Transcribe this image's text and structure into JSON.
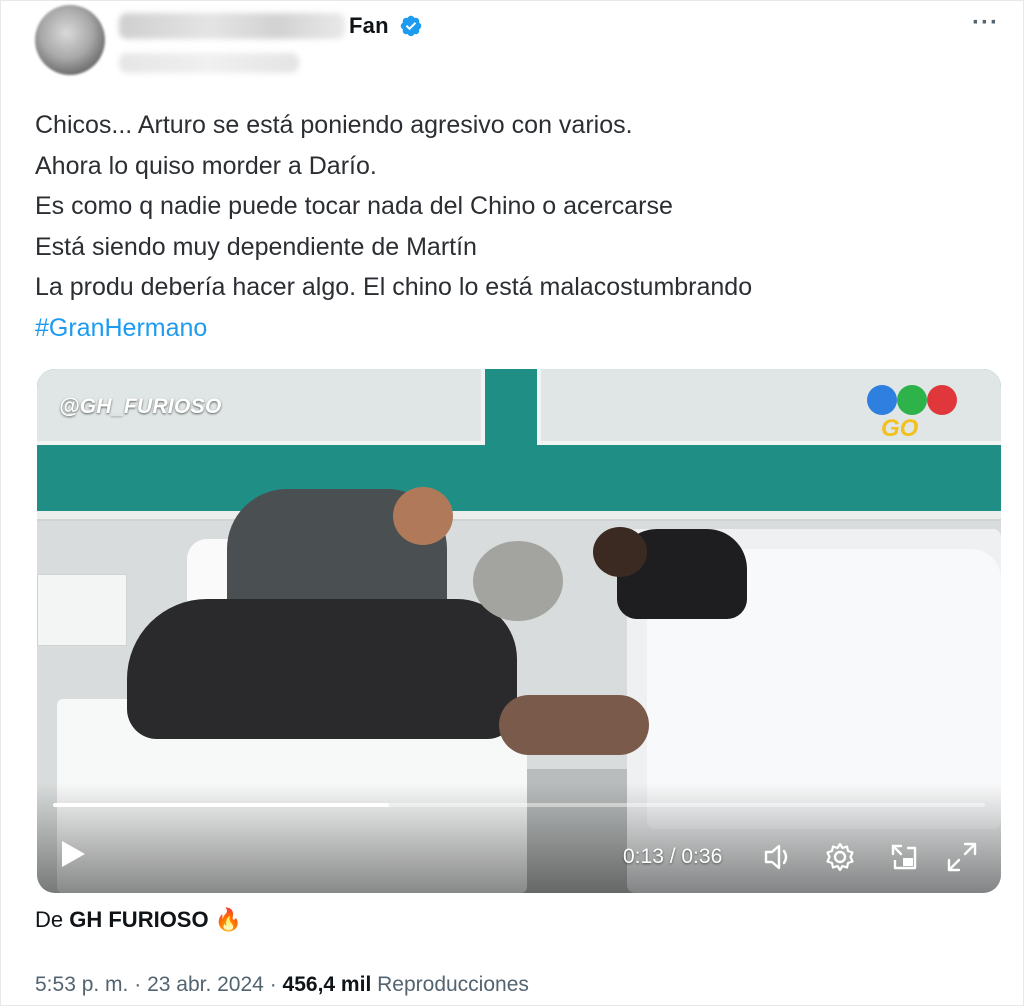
{
  "header": {
    "name_suffix": "Fan",
    "more_label": "···"
  },
  "tweet": {
    "lines": [
      "Chicos... Arturo se está poniendo agresivo con varios.",
      "Ahora lo quiso morder a Darío.",
      "Es como q nadie puede tocar nada del Chino o acercarse",
      "Está siendo muy dependiente de Martín",
      "La produ debería hacer algo. El chino lo está malacostumbrando"
    ],
    "hashtag": "#GranHermano"
  },
  "video": {
    "watermark": "@GH_FURIOSO",
    "channel_logo_text": "GO",
    "time_display": "0:13 / 0:36",
    "progress_fraction": 0.361
  },
  "attribution": {
    "prefix": "De",
    "source": "GH FURIOSO"
  },
  "meta": {
    "time": "5:53 p. m.",
    "separator": "·",
    "date": "23 abr. 2024",
    "views_count": "456,4 mil",
    "views_label": "Reproducciones"
  },
  "colors": {
    "accent": "#1d9bf0",
    "verified": "#1d9bf0",
    "text_secondary": "#536471"
  },
  "icons": [
    "verified-icon",
    "more-icon",
    "play-icon",
    "volume-icon",
    "settings-icon",
    "pip-icon",
    "fullscreen-icon",
    "fire-icon"
  ]
}
